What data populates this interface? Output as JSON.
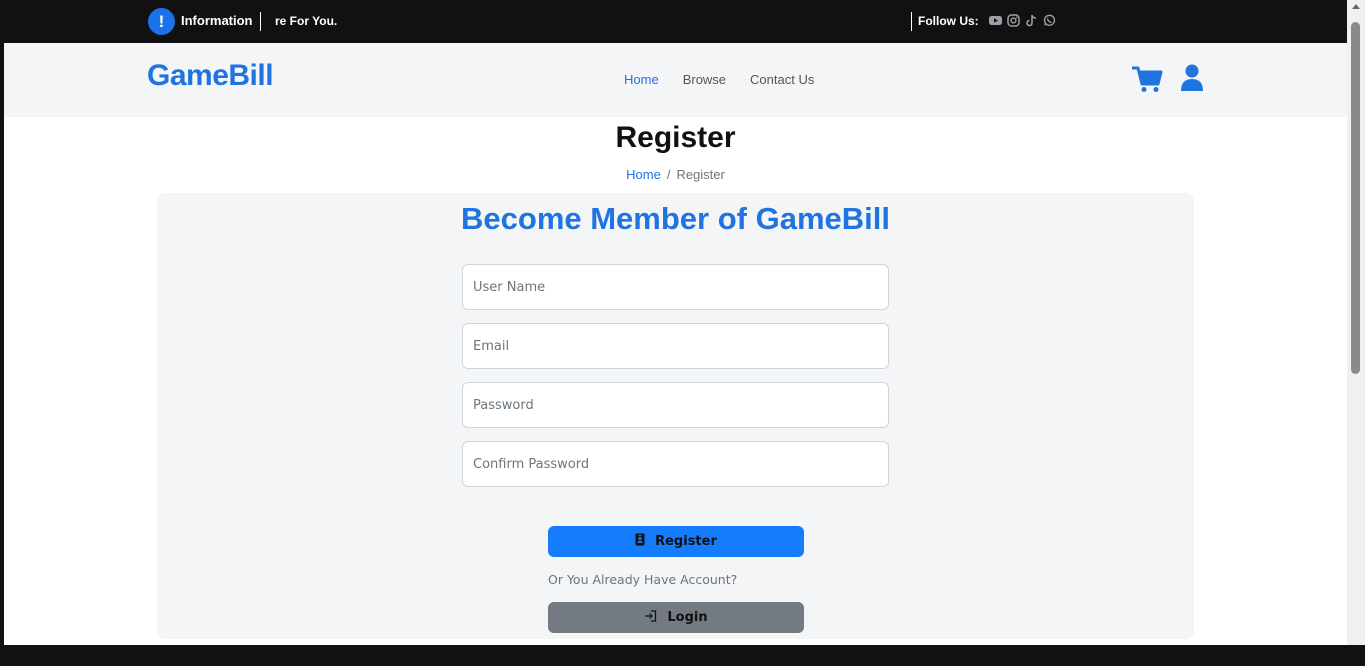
{
  "topbar": {
    "info_icon": "!",
    "info_label": "Information",
    "ticker_text": "re For You.",
    "follow_label": "Follow Us:",
    "social_icons": [
      "youtube-icon",
      "instagram-icon",
      "tiktok-icon",
      "whatsapp-icon"
    ]
  },
  "navbar": {
    "brand": "GameBill",
    "links": [
      {
        "label": "Home",
        "active": true
      },
      {
        "label": "Browse",
        "active": false
      },
      {
        "label": "Contact Us",
        "active": false
      }
    ],
    "icons": [
      "cart-icon",
      "user-icon"
    ],
    "accent_color": "#1f74e0"
  },
  "page": {
    "title": "Register",
    "breadcrumb": {
      "home": "Home",
      "separator": "/",
      "current": "Register"
    }
  },
  "form": {
    "heading": "Become Member of GameBill",
    "fields": {
      "username": {
        "placeholder": "User Name",
        "value": ""
      },
      "email": {
        "placeholder": "Email",
        "value": ""
      },
      "password": {
        "placeholder": "Password",
        "value": ""
      },
      "confirm_password": {
        "placeholder": "Confirm Password",
        "value": ""
      }
    },
    "register_label": "Register",
    "register_color": "#157cfc",
    "or_text": "Or You Already Have Account?",
    "login_label": "Login",
    "login_color": "#737a82"
  }
}
